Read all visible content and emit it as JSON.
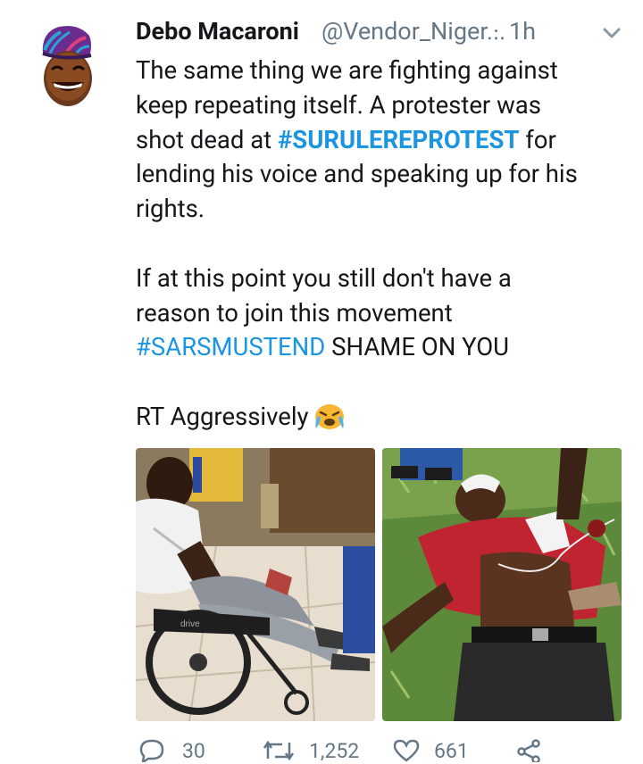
{
  "tweet": {
    "display_name": "Debo Macaroni",
    "handle": "@Vendor_Niger...",
    "separator": "·",
    "time": "1h",
    "lines": [
      {
        "parts": [
          {
            "text": "The same thing we are fighting against",
            "type": "text"
          }
        ]
      },
      {
        "parts": [
          {
            "text": "keep repeating itself. A protester was",
            "type": "text"
          }
        ]
      },
      {
        "parts": [
          {
            "text": "shot dead at ",
            "type": "text"
          },
          {
            "text": "#SURULEREPROTEST",
            "type": "hashtag-bold"
          },
          {
            "text": " for",
            "type": "text"
          }
        ]
      },
      {
        "parts": [
          {
            "text": "lending his voice and speaking up for his",
            "type": "text"
          }
        ]
      },
      {
        "parts": [
          {
            "text": "rights.",
            "type": "text"
          }
        ]
      },
      {
        "gap": true
      },
      {
        "parts": [
          {
            "text": "If at this point you still don't have a",
            "type": "text"
          }
        ]
      },
      {
        "parts": [
          {
            "text": "reason to join this movement",
            "type": "text"
          }
        ]
      },
      {
        "parts": [
          {
            "text": "#SARSMUSTEND",
            "type": "hashtag"
          },
          {
            "text": " SHAME ON YOU",
            "type": "text"
          }
        ]
      },
      {
        "gap": true
      },
      {
        "parts": [
          {
            "text": "RT Aggressively",
            "type": "text"
          }
        ],
        "emoji": "crying-face-emoji"
      }
    ],
    "photos": [
      {
        "name": "photo-left",
        "icon": "photo-injured-man-wheelchair"
      },
      {
        "name": "photo-right",
        "icon": "photo-man-lying-on-grass"
      }
    ],
    "actions": {
      "reply_count": "30",
      "retweet_count": "1,252",
      "like_count": "661"
    }
  },
  "colors": {
    "link": "#1b95e0",
    "secondary": "#657786",
    "text": "#14171a"
  }
}
